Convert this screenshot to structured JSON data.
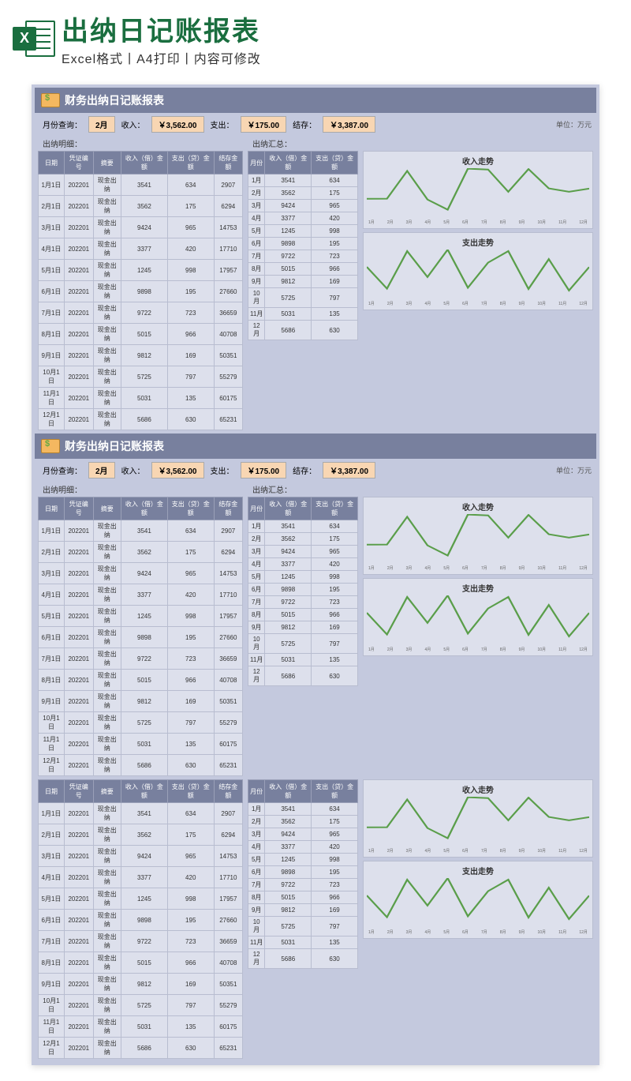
{
  "banner": {
    "title": "出纳日记账报表",
    "subtitle": "Excel格式丨A4打印丨内容可修改",
    "badge": "X"
  },
  "report_title": "财务出纳日记账报表",
  "query": {
    "month_label": "月份查询：",
    "month": "2月",
    "income_label": "收入：",
    "income": "￥3,562.00",
    "expense_label": "支出：",
    "expense": "￥175.00",
    "balance_label": "结存：",
    "balance": "￥3,387.00",
    "unit": "单位：万元"
  },
  "detail_label": "出纳明细：",
  "summary_label": "出纳汇总：",
  "detail_headers": [
    "日期",
    "凭证编号",
    "摘要",
    "收入（借）金额",
    "支出（贷）金额",
    "结存金额"
  ],
  "summary_headers": [
    "月份",
    "收入（借）金额",
    "支出（贷）金额"
  ],
  "detail_rows": [
    [
      "1月1日",
      "202201",
      "现金出纳",
      "3541",
      "634",
      "2907"
    ],
    [
      "2月1日",
      "202201",
      "现金出纳",
      "3562",
      "175",
      "6294"
    ],
    [
      "3月1日",
      "202201",
      "现金出纳",
      "9424",
      "965",
      "14753"
    ],
    [
      "4月1日",
      "202201",
      "现金出纳",
      "3377",
      "420",
      "17710"
    ],
    [
      "5月1日",
      "202201",
      "现金出纳",
      "1245",
      "998",
      "17957"
    ],
    [
      "6月1日",
      "202201",
      "现金出纳",
      "9898",
      "195",
      "27660"
    ],
    [
      "7月1日",
      "202201",
      "现金出纳",
      "9722",
      "723",
      "36659"
    ],
    [
      "8月1日",
      "202201",
      "现金出纳",
      "5015",
      "966",
      "40708"
    ],
    [
      "9月1日",
      "202201",
      "现金出纳",
      "9812",
      "169",
      "50351"
    ],
    [
      "10月1日",
      "202201",
      "现金出纳",
      "5725",
      "797",
      "55279"
    ],
    [
      "11月1日",
      "202201",
      "现金出纳",
      "5031",
      "135",
      "60175"
    ],
    [
      "12月1日",
      "202201",
      "现金出纳",
      "5686",
      "630",
      "65231"
    ]
  ],
  "summary_rows": [
    [
      "1月",
      "3541",
      "634"
    ],
    [
      "2月",
      "3562",
      "175"
    ],
    [
      "3月",
      "9424",
      "965"
    ],
    [
      "4月",
      "3377",
      "420"
    ],
    [
      "5月",
      "1245",
      "998"
    ],
    [
      "6月",
      "9898",
      "195"
    ],
    [
      "7月",
      "9722",
      "723"
    ],
    [
      "8月",
      "5015",
      "966"
    ],
    [
      "9月",
      "9812",
      "169"
    ],
    [
      "10月",
      "5725",
      "797"
    ],
    [
      "11月",
      "5031",
      "135"
    ],
    [
      "12月",
      "5686",
      "630"
    ]
  ],
  "chart_income_title": "收入走势",
  "chart_expense_title": "支出走势",
  "chart_xaxis": [
    "1月",
    "2月",
    "3月",
    "4月",
    "5月",
    "6月",
    "7月",
    "8月",
    "9月",
    "10月",
    "11月",
    "12月"
  ],
  "chart_data": [
    {
      "type": "line",
      "title": "收入走势",
      "xlabel": "",
      "ylabel": "",
      "categories": [
        "1月",
        "2月",
        "3月",
        "4月",
        "5月",
        "6月",
        "7月",
        "8月",
        "9月",
        "10月",
        "11月",
        "12月"
      ],
      "values": [
        3541,
        3562,
        9424,
        3377,
        1245,
        9898,
        9722,
        5015,
        9812,
        5725,
        5031,
        5686
      ],
      "ylim": [
        0,
        10000
      ]
    },
    {
      "type": "line",
      "title": "支出走势",
      "xlabel": "",
      "ylabel": "",
      "categories": [
        "1月",
        "2月",
        "3月",
        "4月",
        "5月",
        "6月",
        "7月",
        "8月",
        "9月",
        "10月",
        "11月",
        "12月"
      ],
      "values": [
        634,
        175,
        965,
        420,
        998,
        195,
        723,
        966,
        169,
        797,
        135,
        630
      ],
      "ylim": [
        0,
        1000
      ]
    }
  ]
}
